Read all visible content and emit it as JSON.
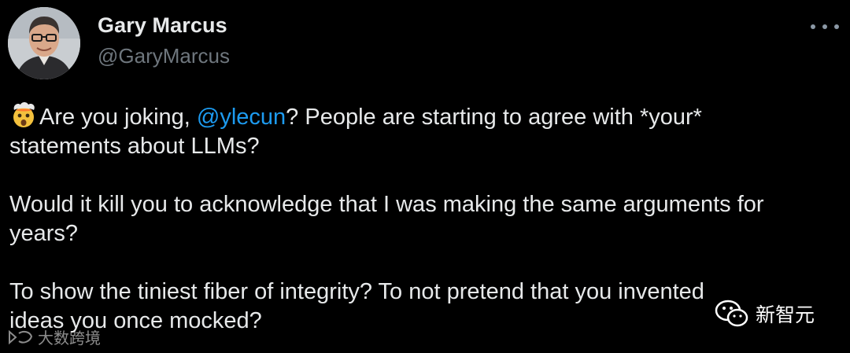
{
  "author": {
    "display_name": "Gary Marcus",
    "handle": "@GaryMarcus",
    "avatar_icon": "profile-photo"
  },
  "more_menu_icon": "more-dots-icon",
  "tweet": {
    "emoji": "exploding-head-emoji",
    "p1": {
      "part1": "Are you joking, ",
      "mention": "@ylecun",
      "part2": "? People are starting to agree with *your*",
      "line2": "statements about LLMs?"
    },
    "p2": {
      "line1": "Would it kill you to acknowledge that I was making the same arguments for",
      "line2": "years?"
    },
    "p3": {
      "line1": "To show the tiniest fiber of integrity? To not pretend that you invented",
      "line2": "ideas you once mocked?"
    }
  },
  "watermarks": {
    "right": "新智元",
    "left": "大数跨境"
  },
  "colors": {
    "background": "#000000",
    "text": "#e7e9ea",
    "secondary": "#6e767d",
    "mention": "#1d9bf0"
  }
}
